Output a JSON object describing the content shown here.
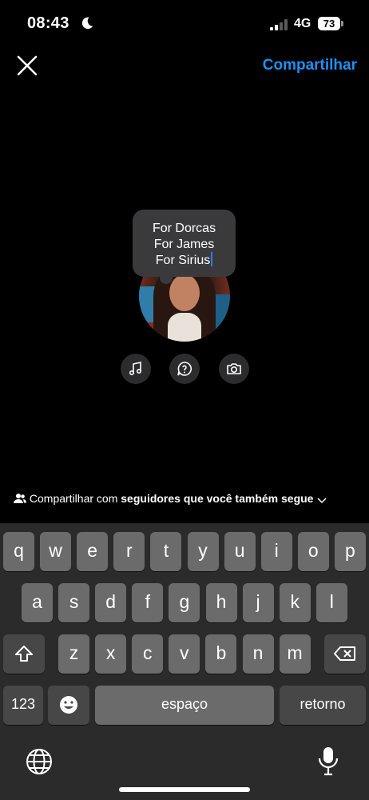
{
  "status_bar": {
    "time": "08:43",
    "network": "4G",
    "battery": "73"
  },
  "header": {
    "share_label": "Compartilhar"
  },
  "note": {
    "lines": [
      "For Dorcas",
      "For James",
      "For Sirius"
    ]
  },
  "tools": [
    "music-icon",
    "question-icon",
    "camera-icon"
  ],
  "audience": {
    "prefix": "Compartilhar com",
    "bold": "seguidores que você também segue"
  },
  "keyboard": {
    "row1": [
      "q",
      "w",
      "e",
      "r",
      "t",
      "y",
      "u",
      "i",
      "o",
      "p"
    ],
    "row2": [
      "a",
      "s",
      "d",
      "f",
      "g",
      "h",
      "j",
      "k",
      "l"
    ],
    "row3": [
      "z",
      "x",
      "c",
      "v",
      "b",
      "n",
      "m"
    ],
    "numbers_label": "123",
    "space_label": "espaço",
    "return_label": "retorno"
  },
  "colors": {
    "accent": "#1e90f5",
    "caret": "#3478f6",
    "key": "#6b6b6b",
    "key_dark": "#474747",
    "keyboard_bg": "#2b2b2b"
  }
}
